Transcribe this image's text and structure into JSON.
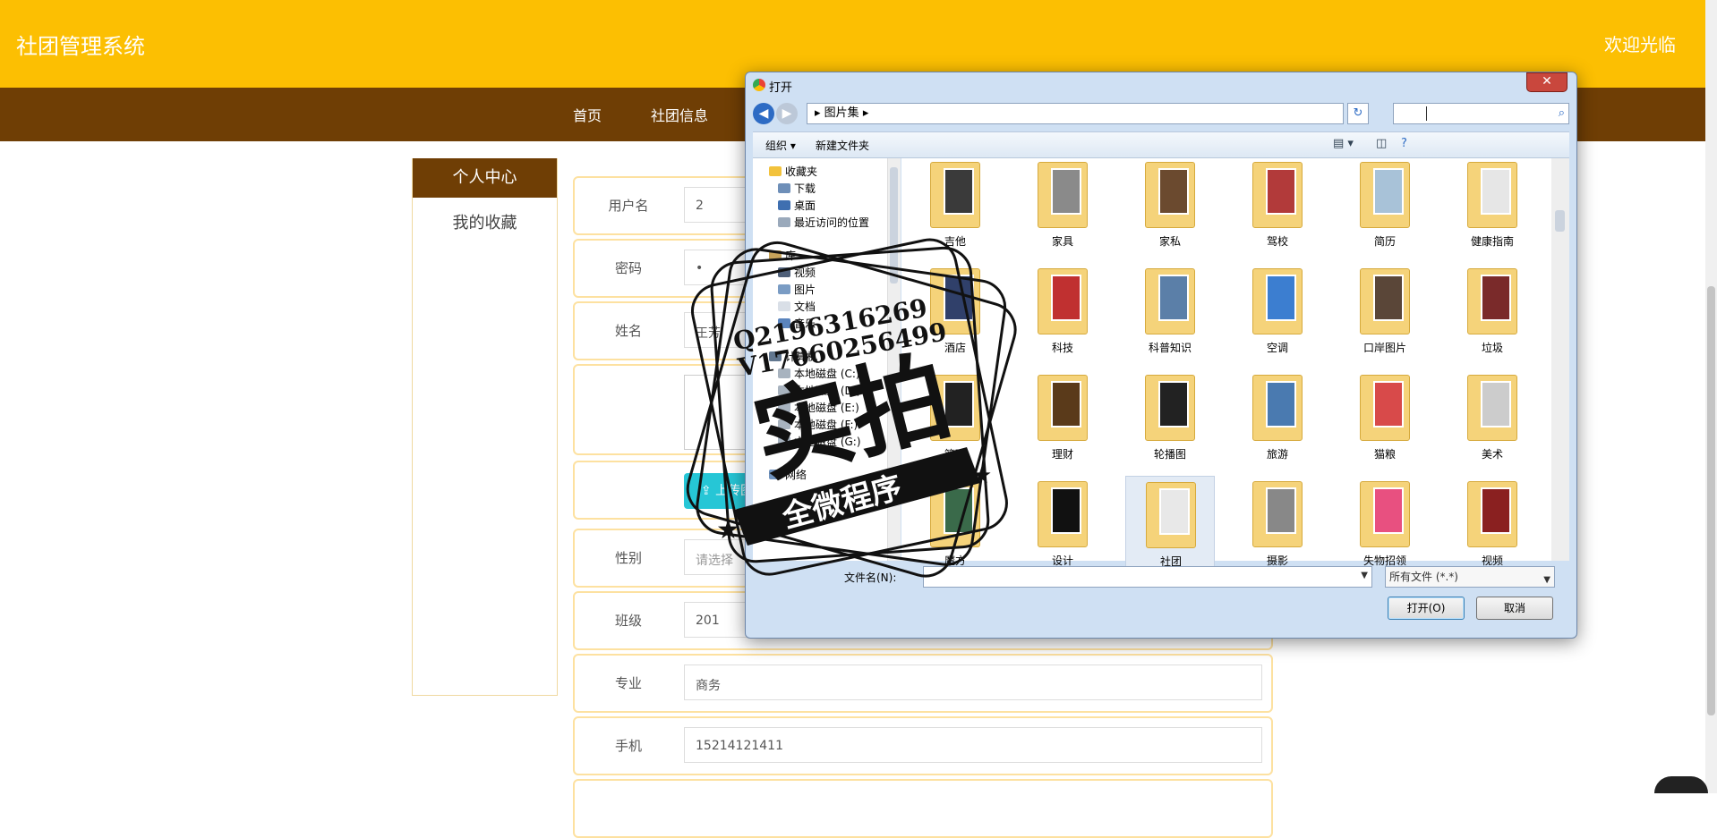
{
  "header": {
    "title": "社团管理系统",
    "welcome": "欢迎光临"
  },
  "nav": {
    "items": [
      "首页",
      "社团信息"
    ]
  },
  "sidebar": {
    "title": "个人中心",
    "items": [
      "我的收藏"
    ]
  },
  "form": {
    "username": {
      "label": "用户名",
      "value": "2"
    },
    "password": {
      "label": "密码",
      "value": "•"
    },
    "name": {
      "label": "姓名",
      "value": "王芳"
    },
    "upload": {
      "label": "上传图片"
    },
    "gender": {
      "label": "性别",
      "placeholder": "请选择"
    },
    "class": {
      "label": "班级",
      "value": "201"
    },
    "major": {
      "label": "专业",
      "value": "商务"
    },
    "phone": {
      "label": "手机",
      "value": "15214121411"
    }
  },
  "dialog": {
    "title": "打开",
    "close": "✕",
    "path": "图片集",
    "toolbar": {
      "organize": "组织 ▾",
      "new_folder": "新建文件夹"
    },
    "tree": {
      "favorites": "收藏夹",
      "downloads": "下载",
      "desktop": "桌面",
      "recent": "最近访问的位置",
      "libraries": "库",
      "videos": "视频",
      "pictures": "图片",
      "documents": "文档",
      "music": "音乐",
      "computer": "计算机",
      "disk_c": "本地磁盘 (C:)",
      "disk_d": "本地磁盘 (D:)",
      "disk_e": "本地磁盘 (E:)",
      "disk_f": "本地磁盘 (F:)",
      "disk_g": "本地磁盘 (G:)",
      "network": "网络"
    },
    "folders": [
      "吉他",
      "家具",
      "家私",
      "驾校",
      "简历",
      "健康指南",
      "酒店",
      "科技",
      "科普知识",
      "空调",
      "口岸图片",
      "垃圾",
      "篮球",
      "理财",
      "轮播图",
      "旅游",
      "猫粮",
      "美术",
      "魔方",
      "设计",
      "社团",
      "摄影",
      "失物招领",
      "视频"
    ],
    "file_name_label": "文件名(N):",
    "file_type": "所有文件 (*.*)",
    "open_button": "打开(O)",
    "cancel_button": "取消"
  },
  "watermark": {
    "qq": "Q2196316269",
    "vx": "V17060256499",
    "big": "实拍",
    "banner": "全微程序"
  },
  "colors": {
    "header": "#fcbf02",
    "nav": "#6f3e05",
    "accent": "#26c6d6"
  }
}
